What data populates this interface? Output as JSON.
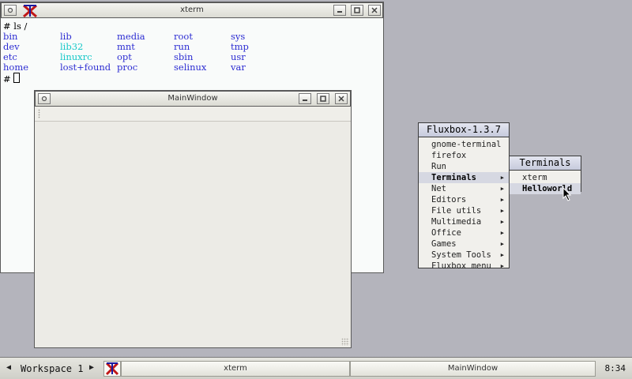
{
  "xterm": {
    "title": "xterm",
    "command_line": "# ls /",
    "prompt": "#",
    "ls_rows": [
      [
        "bin",
        "lib",
        "media",
        "root",
        "sys"
      ],
      [
        "dev",
        "lib32",
        "mnt",
        "run",
        "tmp"
      ],
      [
        "etc",
        "linuxrc",
        "opt",
        "sbin",
        "usr"
      ],
      [
        "home",
        "lost+found",
        "proc",
        "selinux",
        "var"
      ]
    ],
    "symlink_entries": [
      "lib32",
      "linuxrc"
    ],
    "dir_color": "#2c2cd2",
    "symlink_color": "#18c8c8"
  },
  "main_window": {
    "title": "MainWindow"
  },
  "fluxbox_menu": {
    "title": "Fluxbox-1.3.7",
    "items": [
      {
        "label": "gnome-terminal",
        "submenu": false
      },
      {
        "label": "firefox",
        "submenu": false
      },
      {
        "label": "Run",
        "submenu": false
      },
      {
        "label": "Terminals",
        "submenu": true,
        "active": true
      },
      {
        "label": "Net",
        "submenu": true
      },
      {
        "label": "Editors",
        "submenu": true
      },
      {
        "label": "File utils",
        "submenu": true
      },
      {
        "label": "Multimedia",
        "submenu": true
      },
      {
        "label": "Office",
        "submenu": true
      },
      {
        "label": "Games",
        "submenu": true
      },
      {
        "label": "System Tools",
        "submenu": true
      },
      {
        "label": "Fluxbox menu",
        "submenu": true
      }
    ]
  },
  "terminals_submenu": {
    "title": "Terminals",
    "items": [
      {
        "label": "xterm",
        "active": false
      },
      {
        "label": "Helloworld",
        "active": true
      }
    ]
  },
  "taskbar": {
    "workspace": "Workspace 1",
    "tasks": [
      "xterm",
      "MainWindow"
    ],
    "clock": "8:34",
    "icon": "x-window-logo-icon"
  },
  "window_buttons": [
    "menu-icon",
    "minimize-icon",
    "maximize-icon",
    "close-icon"
  ]
}
